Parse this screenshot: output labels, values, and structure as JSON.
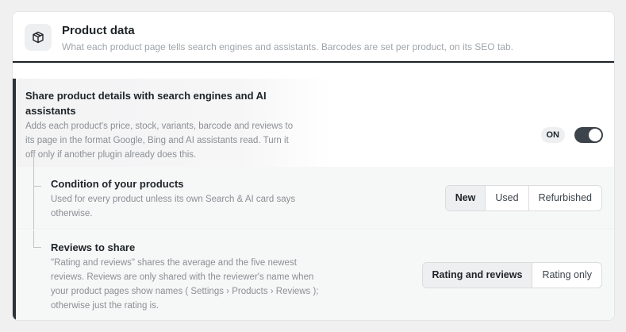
{
  "header": {
    "icon": "box-icon",
    "title": "Product data",
    "subtitle": "What each product page tells search engines and assistants. Barcodes are set per product, on its SEO tab."
  },
  "master": {
    "title": "Share product details with search engines and AI assistants",
    "description": "Adds each product's price, stock, variants, barcode and reviews to its page in the format Google, Bing and AI assistants read. Turn it off only if another plugin already does this.",
    "status_label": "ON",
    "enabled": true
  },
  "condition": {
    "title": "Condition of your products",
    "description": "Used for every product unless its own Search & AI card says otherwise.",
    "options": [
      "New",
      "Used",
      "Refurbished"
    ],
    "selected": "New"
  },
  "reviews": {
    "title": "Reviews to share",
    "description": "\"Rating and reviews\" shares the average and the five newest reviews. Reviews are only shared with the reviewer's name when your product pages show names ( Settings › Products › Reviews ); otherwise just the rating is.",
    "options": [
      "Rating and reviews",
      "Rating only"
    ],
    "selected": "Rating and reviews"
  },
  "colors": {
    "accent": "#2c3338",
    "toggle_on": "#3c434a",
    "muted_text": "#8c8f94"
  }
}
